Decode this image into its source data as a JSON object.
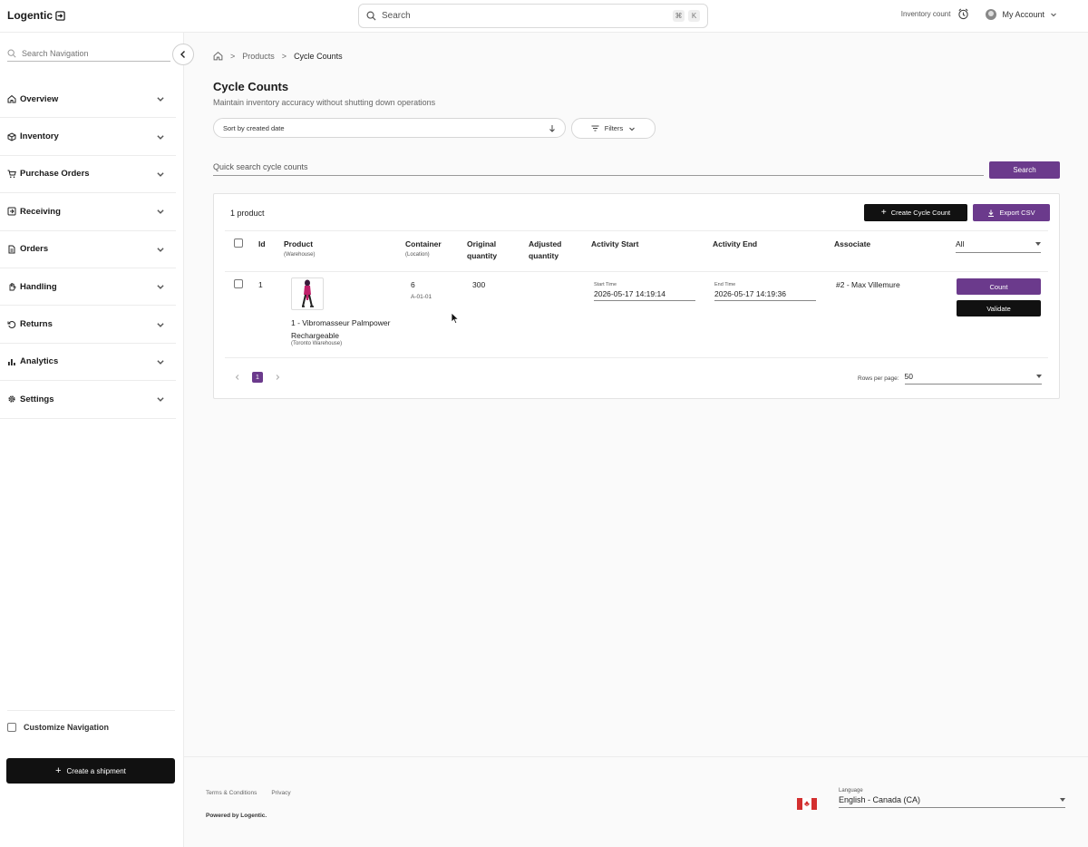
{
  "app": {
    "name": "Logentic"
  },
  "topbar": {
    "search_placeholder": "Search",
    "kbd_cmd": "⌘",
    "kbd_k": "K",
    "inventory_count": "Inventory count",
    "account": "My Account"
  },
  "sidebar": {
    "search_placeholder": "Search Navigation",
    "items": [
      {
        "label": "Overview",
        "icon": "home-icon"
      },
      {
        "label": "Inventory",
        "icon": "box-icon"
      },
      {
        "label": "Purchase Orders",
        "icon": "cart-icon"
      },
      {
        "label": "Receiving",
        "icon": "receive-icon"
      },
      {
        "label": "Orders",
        "icon": "document-icon"
      },
      {
        "label": "Handling",
        "icon": "hand-icon"
      },
      {
        "label": "Returns",
        "icon": "return-icon"
      },
      {
        "label": "Analytics",
        "icon": "bar-chart-icon"
      },
      {
        "label": "Settings",
        "icon": "gear-icon"
      }
    ],
    "customize_label": "Customize Navigation",
    "create_shipment": "Create a shipment"
  },
  "breadcrumb": {
    "items": [
      "Products",
      "Cycle Counts"
    ]
  },
  "page": {
    "title": "Cycle Counts",
    "subtitle": "Maintain inventory accuracy without shutting down operations",
    "sort_label": "Sort by created date",
    "filters_label": "Filters",
    "quick_search_placeholder": "Quick search cycle counts",
    "search_button": "Search"
  },
  "table": {
    "count_label": "1 product",
    "create_button": "Create Cycle Count",
    "export_button": "Export CSV",
    "columns": {
      "id": "Id",
      "product": "Product",
      "product_sub": "(Warehouse)",
      "container": "Container",
      "container_sub": "(Location)",
      "original": "Original",
      "original2": "quantity",
      "adjusted": "Adjusted",
      "adjusted2": "quantity",
      "activity_start": "Activity Start",
      "activity_end": "Activity End",
      "associate": "Associate",
      "filter_value": "All"
    },
    "rows": [
      {
        "id": "1",
        "product_name": "1 - Vibromasseur Palmpower Rechargeable",
        "warehouse": "(Toronto Warehouse)",
        "container": "6",
        "location": "A-01-01",
        "original_qty": "300",
        "adjusted_qty": "",
        "start_caption": "Start Time",
        "start_time": "2026-05-17 14:19:14",
        "end_caption": "End Time",
        "end_time": "2026-05-17 14:19:36",
        "associate": "#2 - Max Villemure",
        "count_button": "Count",
        "validate_button": "Validate"
      }
    ],
    "pagination": {
      "current_page": "1",
      "rows_per_page_label": "Rows per page:",
      "rows_per_page": "50"
    }
  },
  "footer": {
    "terms": "Terms & Conditions",
    "privacy": "Privacy",
    "powered": "Powered by Logentic.",
    "language_caption": "Language",
    "language_value": "English - Canada (CA)"
  },
  "colors": {
    "accent": "#6b3a8c",
    "dark": "#111111"
  }
}
